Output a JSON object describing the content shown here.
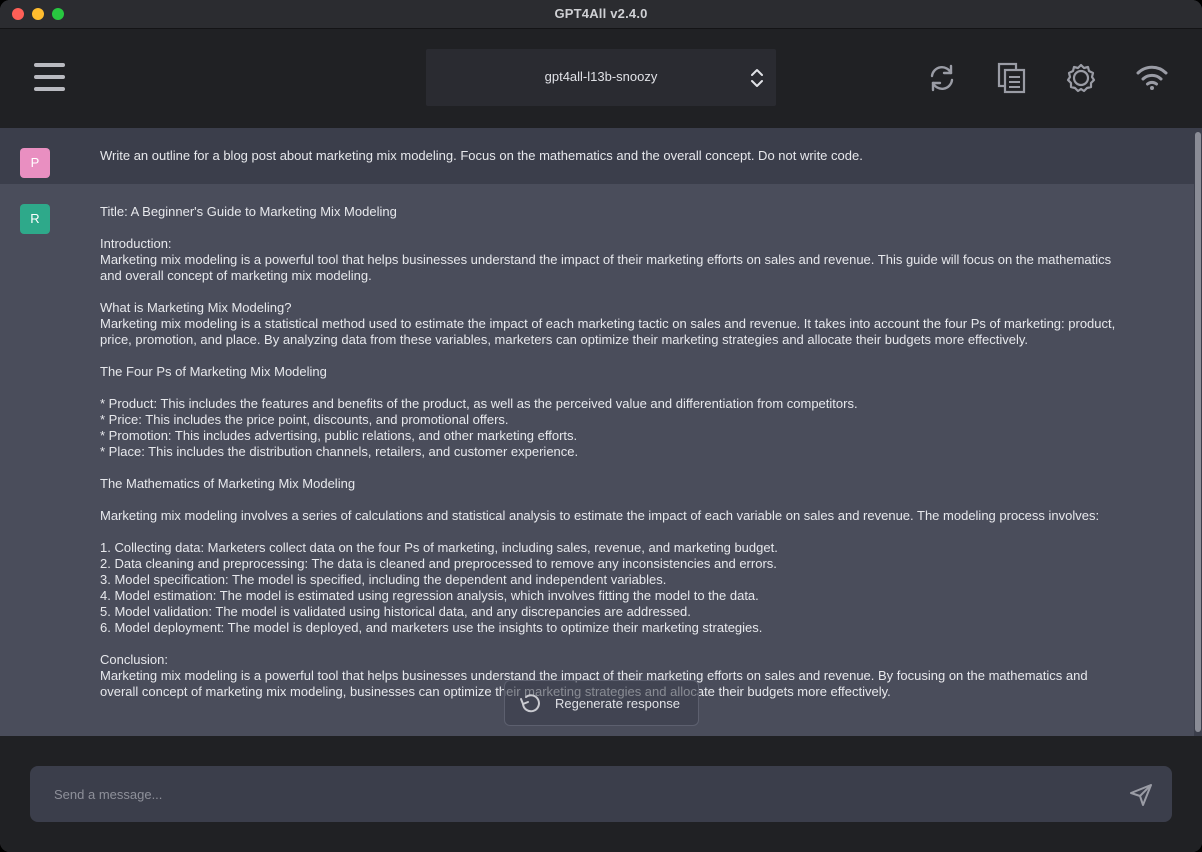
{
  "window": {
    "title": "GPT4All v2.4.0",
    "close_color": "#ff5f57",
    "minimize_color": "#febc2e",
    "maximize_color": "#28c840"
  },
  "header": {
    "menu_icon": "hamburger-menu-icon",
    "model_select": {
      "value": "gpt4all-l13b-snoozy",
      "icon": "chevron-up-down-icon"
    },
    "actions": [
      {
        "name": "reset-chat",
        "icon": "refresh-icon"
      },
      {
        "name": "copy-conversation",
        "icon": "copy-document-icon"
      },
      {
        "name": "settings",
        "icon": "gear-icon"
      },
      {
        "name": "network",
        "icon": "wifi-icon"
      }
    ]
  },
  "chat": {
    "prompt": {
      "avatar": "P",
      "avatar_color": "#e98fc1",
      "text": "Write an outline for a blog post about marketing mix modeling. Focus on the mathematics and the overall concept. Do not write code."
    },
    "response": {
      "avatar": "R",
      "avatar_color": "#2ea98a",
      "text": "Title: A Beginner's Guide to Marketing Mix Modeling\n\nIntroduction:\nMarketing mix modeling is a powerful tool that helps businesses understand the impact of their marketing efforts on sales and revenue. This guide will focus on the mathematics and overall concept of marketing mix modeling.\n\nWhat is Marketing Mix Modeling?\nMarketing mix modeling is a statistical method used to estimate the impact of each marketing tactic on sales and revenue. It takes into account the four Ps of marketing: product, price, promotion, and place. By analyzing data from these variables, marketers can optimize their marketing strategies and allocate their budgets more effectively.\n\nThe Four Ps of Marketing Mix Modeling\n\n* Product: This includes the features and benefits of the product, as well as the perceived value and differentiation from competitors.\n* Price: This includes the price point, discounts, and promotional offers.\n* Promotion: This includes advertising, public relations, and other marketing efforts.\n* Place: This includes the distribution channels, retailers, and customer experience.\n\nThe Mathematics of Marketing Mix Modeling\n\nMarketing mix modeling involves a series of calculations and statistical analysis to estimate the impact of each variable on sales and revenue. The modeling process involves:\n\n1. Collecting data: Marketers collect data on the four Ps of marketing, including sales, revenue, and marketing budget.\n2. Data cleaning and preprocessing: The data is cleaned and preprocessed to remove any inconsistencies and errors.\n3. Model specification: The model is specified, including the dependent and independent variables.\n4. Model estimation: The model is estimated using regression analysis, which involves fitting the model to the data.\n5. Model validation: The model is validated using historical data, and any discrepancies are addressed.\n6. Model deployment: The model is deployed, and marketers use the insights to optimize their marketing strategies.\n\nConclusion:\nMarketing mix modeling is a powerful tool that helps businesses understand the impact of their marketing efforts on sales and revenue. By focusing on the mathematics and overall concept of marketing mix modeling, businesses can optimize their marketing strategies and allocate their budgets more effectively."
    },
    "regenerate_label": "Regenerate response",
    "regenerate_icon": "regenerate-icon"
  },
  "footer": {
    "input_placeholder": "Send a message...",
    "input_value": "",
    "send_icon": "send-icon"
  },
  "colors": {
    "background": "#202124",
    "chat_prompt_bg": "#3b3e4b",
    "chat_response_bg": "#4a4d5b",
    "text": "#e7e8ec"
  }
}
